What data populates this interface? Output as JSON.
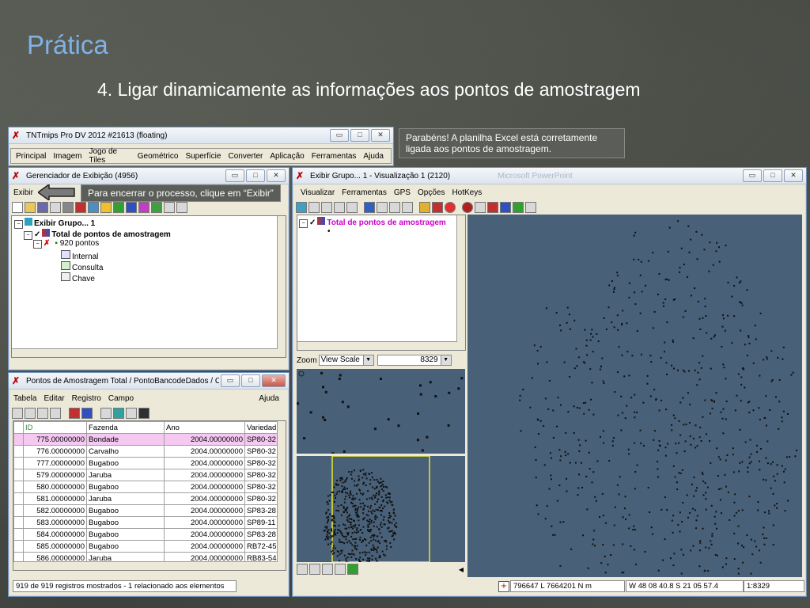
{
  "slide": {
    "title": "Prática",
    "subtitle": "4. Ligar dinamicamente as informações aos pontos de amostragem"
  },
  "main_window": {
    "title": "TNTmips Pro DV 2012  #21613 (floating)",
    "menu": [
      "Principal",
      "Imagem",
      "Jogo de Tiles",
      "Geométrico",
      "Superfície",
      "Converter",
      "Aplicação",
      "Ferramentas",
      "Ajuda"
    ]
  },
  "callouts": {
    "success": "Parabéns! A planilha Excel está corretamente ligada aos pontos de amostragem.",
    "exit_hint": "Para encerrar o processo, clique em “Exibir”"
  },
  "display_manager": {
    "title": "Gerenciador de Exibição (4956)",
    "menu_first": "Exibir",
    "tree": [
      {
        "label": "Exibir Grupo... 1"
      },
      {
        "label": "Total de pontos de amostragem"
      },
      {
        "label": "920 pontos"
      },
      {
        "label": "Internal"
      },
      {
        "label": "Consulta"
      },
      {
        "label": "Chave"
      }
    ]
  },
  "table_window": {
    "title": "Pontos de Amostragem Total / PontoBancodeDados / Consu...",
    "menu": [
      "Tabela",
      "Editar",
      "Registro",
      "Campo"
    ],
    "menu_right": "Ajuda",
    "columns": [
      "ID",
      "Fazenda",
      "Ano",
      "Variedad"
    ],
    "rows": [
      [
        "775.00000000",
        "Bondade",
        "2004.00000000",
        "SP80-32"
      ],
      [
        "776.00000000",
        "Carvalho",
        "2004.00000000",
        "SP80-32"
      ],
      [
        "777.00000000",
        "Bugaboo",
        "2004.00000000",
        "SP80-32"
      ],
      [
        "579.00000000",
        "Jaruba",
        "2004.00000000",
        "SP80-32"
      ],
      [
        "580.00000000",
        "Bugaboo",
        "2004.00000000",
        "SP80-32"
      ],
      [
        "581.00000000",
        "Jaruba",
        "2004.00000000",
        "SP80-32"
      ],
      [
        "582.00000000",
        "Bugaboo",
        "2004.00000000",
        "SP83-28"
      ],
      [
        "583.00000000",
        "Bugaboo",
        "2004.00000000",
        "SP89-11"
      ],
      [
        "584.00000000",
        "Bugaboo",
        "2004.00000000",
        "SP83-28"
      ],
      [
        "585.00000000",
        "Bugaboo",
        "2004.00000000",
        "RB72-45"
      ],
      [
        "586.00000000",
        "Jaruba",
        "2004.00000000",
        "RB83-54"
      ]
    ],
    "status": "919 de 919 registros mostrados - 1 relacionado aos elementos"
  },
  "view_window": {
    "title": "Exibir Grupo... 1 - Visualização 1 (2120)",
    "ghost_title": "Microsoft PowerPoint",
    "menu": [
      "Visualizar",
      "Ferramentas",
      "GPS",
      "Opções",
      "HotKeys"
    ],
    "legend_label": "Total de pontos de amostragem",
    "zoom_label": "Zoom",
    "zoom_mode": "View Scale",
    "zoom_value": "8329",
    "status_coords": "796647 L  7664201 N m",
    "status_geo": "W 48 08 40.8  S 21 05 57.4",
    "status_scale": "1:8329"
  },
  "colors": {
    "map_bg": "#486078",
    "title_accent": "#7fb2e6",
    "legend_text": "#cc00cc",
    "selected_row": "#f4c8f0"
  }
}
